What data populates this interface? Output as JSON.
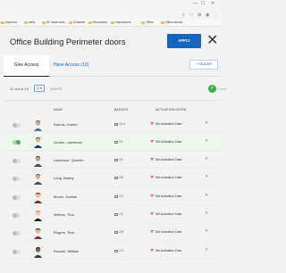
{
  "browser": {
    "bookmarks": [
      "Imported",
      "wells",
      "IR Trade tools",
      "Software",
      "Resources",
      "Impromptus",
      "Office",
      "Office-ethaar"
    ]
  },
  "header": {
    "title": "Office Building Perimeter doors",
    "apply_label": "APPLY",
    "close_glyph": "✕"
  },
  "tabs": {
    "give_access": "Give Access",
    "have_access": "Have Access (12)"
  },
  "reader_label": "+ READER",
  "filter": {
    "count": "11 out of 14",
    "toggle_label": "Q ▾",
    "search_placeholder": "Search",
    "selected_text": "0 sele"
  },
  "columns": {
    "name": "NAME",
    "badges": "BADGES",
    "activation": "ACTIVATION DATES"
  },
  "rows": [
    {
      "name": "Dubois, Hubert",
      "badge": "1/14",
      "activation": "Set Activation Date",
      "selected": false
    },
    {
      "name": "Gruber, Lawrence",
      "badge": "1/1",
      "activation": "Set Activation Date",
      "selected": true
    },
    {
      "name": "Lawrence, Quentin",
      "badge": "1/1",
      "activation": "Set Activation Date",
      "selected": false
    },
    {
      "name": "Long, Bobby",
      "badge": "3/8",
      "activation": "Set Activation Date",
      "selected": false
    },
    {
      "name": "Moore, Debbie",
      "badge": "1/2",
      "activation": "Set Activation Date",
      "selected": false
    },
    {
      "name": "Mellors, Tina",
      "badge": "1/1",
      "activation": "Set Activation Date",
      "selected": false
    },
    {
      "name": "Rogers, Tina",
      "badge": "1/8",
      "activation": "Set Activation Date",
      "selected": false
    },
    {
      "name": "Russell, William",
      "badge": "1/3",
      "activation": "Set Activation Date",
      "selected": false
    }
  ],
  "colors": {
    "accent": "#1565c0",
    "success": "#3fae49"
  }
}
